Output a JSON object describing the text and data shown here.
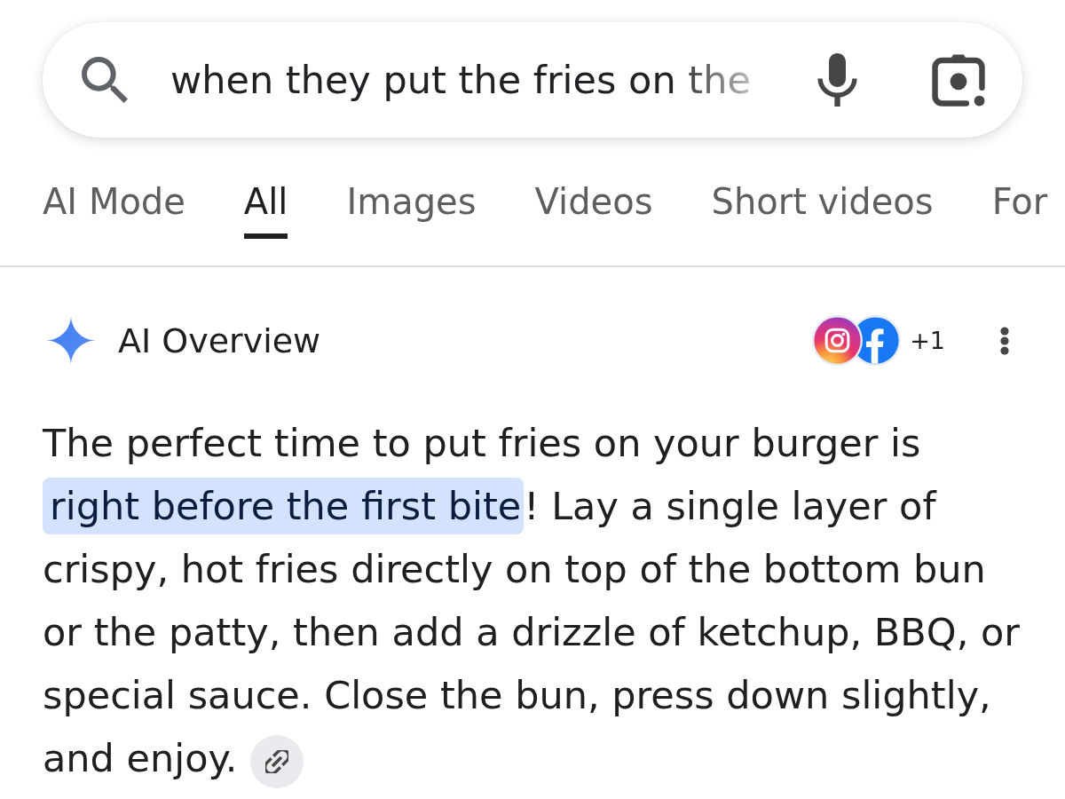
{
  "search": {
    "value": "when they put the fries on the"
  },
  "tabs": [
    {
      "label": "AI Mode",
      "selected": false
    },
    {
      "label": "All",
      "selected": true
    },
    {
      "label": "Images",
      "selected": false
    },
    {
      "label": "Videos",
      "selected": false
    },
    {
      "label": "Short videos",
      "selected": false
    },
    {
      "label": "For",
      "selected": false
    }
  ],
  "ai_overview": {
    "title": "AI Overview",
    "source_count": "+1",
    "paragraph": [
      {
        "text": "The perfect time to put fries on your burger is ",
        "highlighted": false
      },
      {
        "text": "right before the first bite",
        "highlighted": true
      },
      {
        "text": "! Lay a single layer of crispy, hot fries directly on top of the bottom bun or the patty, then add a drizzle of ketchup, BBQ, or special sauce. Close the bun, press down slightly, and enjoy.",
        "highlighted": false
      }
    ]
  }
}
